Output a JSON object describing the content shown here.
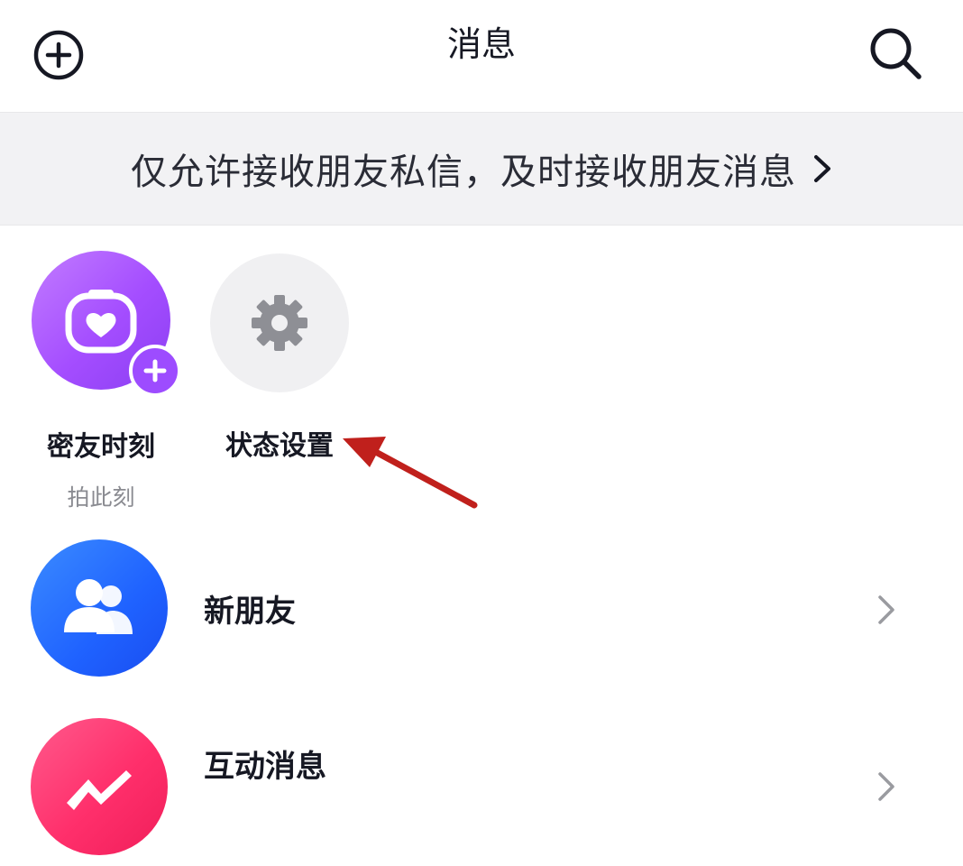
{
  "header": {
    "title": "消息",
    "add_icon": "add-circle-icon",
    "search_icon": "search-icon"
  },
  "banner": {
    "text": "仅允许接收朋友私信，及时接收朋友消息",
    "chevron_icon": "chevron-right-icon"
  },
  "stories": [
    {
      "label": "密友时刻",
      "sub": "拍此刻",
      "icon": "camera-heart-icon",
      "badge_icon": "plus-icon",
      "color": "#a44dff"
    },
    {
      "label": "状态设置",
      "icon": "gear-icon",
      "color": "#f0f0f2"
    }
  ],
  "rows": [
    {
      "label": "新朋友",
      "icon": "users-icon",
      "color": "#1f62ff"
    },
    {
      "label": "互动消息",
      "icon": "lightning-message-icon",
      "color": "#ff2f6b"
    }
  ],
  "annotation": {
    "color": "#c0201c",
    "icon": "red-arrow-annotation"
  }
}
